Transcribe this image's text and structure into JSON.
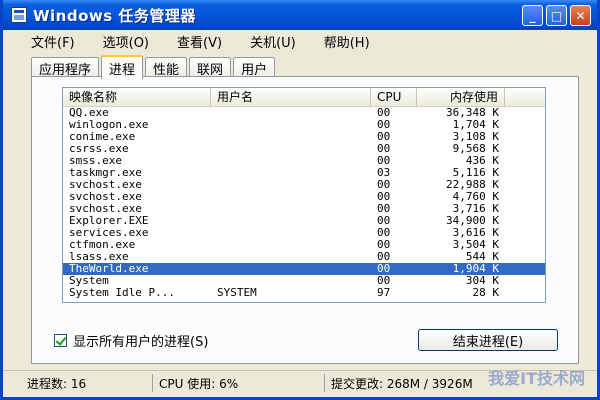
{
  "window": {
    "title": "Windows 任务管理器",
    "buttons": {
      "minimize": "_",
      "maximize": "□",
      "close": "✕"
    }
  },
  "menu": [
    "文件(F)",
    "选项(O)",
    "查看(V)",
    "关机(U)",
    "帮助(H)"
  ],
  "tabs": [
    "应用程序",
    "进程",
    "性能",
    "联网",
    "用户"
  ],
  "active_tab": "进程",
  "columns": {
    "name": "映像名称",
    "user": "用户名",
    "cpu": "CPU",
    "mem": "内存使用"
  },
  "rows": [
    {
      "name": "QQ.exe",
      "user": "",
      "cpu": "00",
      "mem": "36,348 K"
    },
    {
      "name": "winlogon.exe",
      "user": "",
      "cpu": "00",
      "mem": "1,704 K"
    },
    {
      "name": "conime.exe",
      "user": "",
      "cpu": "00",
      "mem": "3,108 K"
    },
    {
      "name": "csrss.exe",
      "user": "",
      "cpu": "00",
      "mem": "9,568 K"
    },
    {
      "name": "smss.exe",
      "user": "",
      "cpu": "00",
      "mem": "436 K"
    },
    {
      "name": "taskmgr.exe",
      "user": "",
      "cpu": "03",
      "mem": "5,116 K"
    },
    {
      "name": "svchost.exe",
      "user": "",
      "cpu": "00",
      "mem": "22,988 K"
    },
    {
      "name": "svchost.exe",
      "user": "",
      "cpu": "00",
      "mem": "4,760 K"
    },
    {
      "name": "svchost.exe",
      "user": "",
      "cpu": "00",
      "mem": "3,716 K"
    },
    {
      "name": "Explorer.EXE",
      "user": "",
      "cpu": "00",
      "mem": "34,900 K"
    },
    {
      "name": "services.exe",
      "user": "",
      "cpu": "00",
      "mem": "3,616 K"
    },
    {
      "name": "ctfmon.exe",
      "user": "",
      "cpu": "00",
      "mem": "3,504 K"
    },
    {
      "name": "lsass.exe",
      "user": "",
      "cpu": "00",
      "mem": "544 K"
    },
    {
      "name": "TheWorld.exe",
      "user": "",
      "cpu": "00",
      "mem": "1,904 K",
      "selected": true
    },
    {
      "name": "System",
      "user": "",
      "cpu": "00",
      "mem": "304 K"
    },
    {
      "name": "System Idle P...",
      "user": "SYSTEM",
      "cpu": "97",
      "mem": "28 K"
    }
  ],
  "show_all_users": {
    "label": "显示所有用户的进程(S)",
    "checked": true
  },
  "end_process_label": "结束进程(E)",
  "status": {
    "processes": "进程数: 16",
    "cpu_usage": "CPU 使用: 6%",
    "commit": "提交更改: 268M / 3926M"
  },
  "watermark": "我爱IT技术网"
}
